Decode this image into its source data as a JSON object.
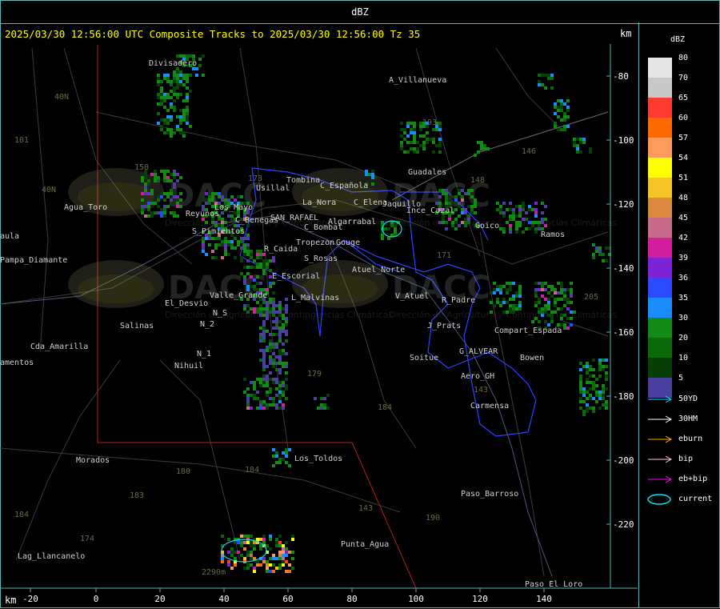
{
  "window": {
    "title": "dBZ"
  },
  "header": {
    "text": "2025/03/30 12:56:00 UTC Composite Tracks to 2025/03/30 12:56:00 Tz 35",
    "unit_top": "km",
    "unit_bottom": "km"
  },
  "axes": {
    "x_ticks": [
      "-20",
      "0",
      "20",
      "40",
      "60",
      "80",
      "100",
      "120",
      "140"
    ],
    "y_ticks": [
      "-80",
      "-100",
      "-120",
      "-140",
      "-160",
      "-180",
      "-200",
      "-220"
    ]
  },
  "legend": {
    "title": "dBZ",
    "levels": [
      {
        "label": "80",
        "color": "#e6e6e6"
      },
      {
        "label": "70",
        "color": "#c8c8c8"
      },
      {
        "label": "65",
        "color": "#ff3b2f"
      },
      {
        "label": "60",
        "color": "#ff6a00"
      },
      {
        "label": "57",
        "color": "#ff9a5a"
      },
      {
        "label": "54",
        "color": "#ffff00"
      },
      {
        "label": "51",
        "color": "#f7c427"
      },
      {
        "label": "48",
        "color": "#d98a3e"
      },
      {
        "label": "45",
        "color": "#c86a8a"
      },
      {
        "label": "42",
        "color": "#d21fa0"
      },
      {
        "label": "39",
        "color": "#7d22d6"
      },
      {
        "label": "36",
        "color": "#2a4bff"
      },
      {
        "label": "35",
        "color": "#1a8cff"
      },
      {
        "label": "30",
        "color": "#138a13"
      },
      {
        "label": "20",
        "color": "#0a6a0a"
      },
      {
        "label": "10",
        "color": "#063f06"
      },
      {
        "label": "5",
        "color": "#4b3fa0"
      }
    ],
    "tracks": [
      {
        "label": "50YD",
        "color": "#00e5ff"
      },
      {
        "label": "30HM",
        "color": "#ffffff"
      },
      {
        "label": "eburn",
        "color": "#ffb000"
      },
      {
        "label": "bip",
        "color": "#ffc8e6"
      },
      {
        "label": "eb+bip",
        "color": "#ff00ff"
      },
      {
        "label": "current",
        "color": "#00e5ff"
      }
    ]
  },
  "places": [
    {
      "name": "Divisadero"
    },
    {
      "name": "A_Villanueva"
    },
    {
      "name": "Guadales"
    },
    {
      "name": "Usillal"
    },
    {
      "name": "Tombina"
    },
    {
      "name": "C_Española"
    },
    {
      "name": "La_Nora"
    },
    {
      "name": "C_Elena"
    },
    {
      "name": "Jaquillo"
    },
    {
      "name": "Agua_Toro"
    },
    {
      "name": "Reyunos"
    },
    {
      "name": "Los_Mayo"
    },
    {
      "name": "C_Benegas"
    },
    {
      "name": "SAN_RAFAEL"
    },
    {
      "name": "Algarrabal"
    },
    {
      "name": "C_Bombal"
    },
    {
      "name": "S_Pimientos"
    },
    {
      "name": "Tropezon"
    },
    {
      "name": "Gouge"
    },
    {
      "name": "R_Caida"
    },
    {
      "name": "S_Rosas"
    },
    {
      "name": "Pampa_Diamante"
    },
    {
      "name": "Atuel_Norte"
    },
    {
      "name": "E_Escorial"
    },
    {
      "name": "El_Desvio"
    },
    {
      "name": "Valle_Grande"
    },
    {
      "name": "L_Malvinas"
    },
    {
      "name": "V_Atuel"
    },
    {
      "name": "R_Padre"
    },
    {
      "name": "Salinas"
    },
    {
      "name": "N_S"
    },
    {
      "name": "N_2"
    },
    {
      "name": "J_Prats"
    },
    {
      "name": "Compart_Espada"
    },
    {
      "name": "Cda_Amarilla"
    },
    {
      "name": "N_1"
    },
    {
      "name": "G_ALVEAR"
    },
    {
      "name": "Soitue"
    },
    {
      "name": "Bowen"
    },
    {
      "name": "Nihuil"
    },
    {
      "name": "Aero_GH"
    },
    {
      "name": "Carmensa"
    },
    {
      "name": "Los_Toldos"
    },
    {
      "name": "Morados"
    },
    {
      "name": "Paso_Barroso"
    },
    {
      "name": "Punta_Agua"
    },
    {
      "name": "Lag_Llancanelo"
    },
    {
      "name": "Paso_El_Loro"
    },
    {
      "name": "Goico"
    },
    {
      "name": "Ramos"
    },
    {
      "name": "Ince_Cazal"
    },
    {
      "name": "amentos"
    },
    {
      "name": "aula"
    }
  ],
  "elevation_numbers": [
    "101",
    "40N",
    "40N",
    "150",
    "173",
    "193",
    "146",
    "148",
    "171",
    "143",
    "179",
    "184",
    "180",
    "184",
    "183",
    "174",
    "190",
    "143",
    "205",
    "184",
    "2290m"
  ],
  "watermark": {
    "text": "DACC",
    "subtitle": "Dirección de Agricultura y Contingencias Climáticas"
  }
}
